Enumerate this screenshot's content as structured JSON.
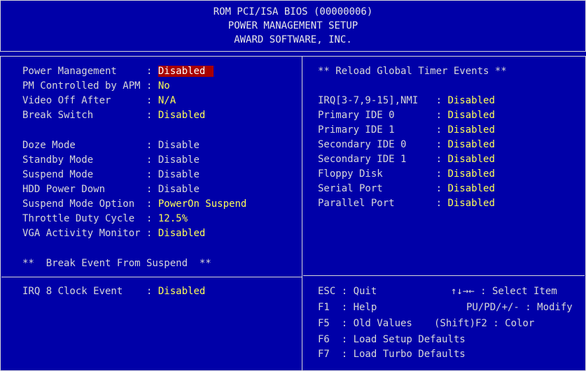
{
  "header": {
    "line1": "ROM PCI/ISA BIOS (00000006)",
    "line2": "POWER MANAGEMENT SETUP",
    "line3": "AWARD SOFTWARE, INC."
  },
  "left": {
    "power_management": {
      "label": "Power Management    ",
      "value": "Disabled"
    },
    "pm_apm": {
      "label": "PM Controlled by APM",
      "value": "No"
    },
    "video_off": {
      "label": "Video Off After     ",
      "value": "N/A"
    },
    "break_switch": {
      "label": "Break Switch        ",
      "value": "Disabled"
    },
    "doze": {
      "label": "Doze Mode           ",
      "value": "Disable"
    },
    "standby": {
      "label": "Standby Mode        ",
      "value": "Disable"
    },
    "suspend": {
      "label": "Suspend Mode        ",
      "value": "Disable"
    },
    "hdd_power": {
      "label": "HDD Power Down      ",
      "value": "Disable"
    },
    "suspend_option": {
      "label": "Suspend Mode Option ",
      "value": "PowerOn Suspend"
    },
    "throttle": {
      "label": "Throttle Duty Cycle ",
      "value": "12.5%"
    },
    "vga_monitor": {
      "label": "VGA Activity Monitor",
      "value": "Disabled"
    },
    "break_event_title": "**  Break Event From Suspend  **",
    "irq8": {
      "label": "IRQ 8 Clock Event   ",
      "value": "Disabled"
    }
  },
  "right": {
    "title": "** Reload Global Timer Events **",
    "items": [
      {
        "label": "IRQ[3-7,9-15],NMI  ",
        "value": "Disabled"
      },
      {
        "label": "Primary IDE 0      ",
        "value": "Disabled"
      },
      {
        "label": "Primary IDE 1      ",
        "value": "Disabled"
      },
      {
        "label": "Secondary IDE 0    ",
        "value": "Disabled"
      },
      {
        "label": "Secondary IDE 1    ",
        "value": "Disabled"
      },
      {
        "label": "Floppy Disk        ",
        "value": "Disabled"
      },
      {
        "label": "Serial Port        ",
        "value": "Disabled"
      },
      {
        "label": "Parallel Port      ",
        "value": "Disabled"
      }
    ]
  },
  "help": {
    "esc": "ESC : Quit",
    "esc_right": "↑↓→← : Select Item",
    "f1": "F1  : Help",
    "f1_right": "PU/PD/+/- : Modify",
    "f5": "F5  : Old Values",
    "f5_right": "(Shift)F2 : Color",
    "f6": "F6  : Load Setup Defaults",
    "f7": "F7  : Load Turbo Defaults"
  },
  "colors": {
    "background": "#0000a8",
    "value": "#ffff55",
    "highlight": "#a80000",
    "text": "#d8d8d8"
  }
}
